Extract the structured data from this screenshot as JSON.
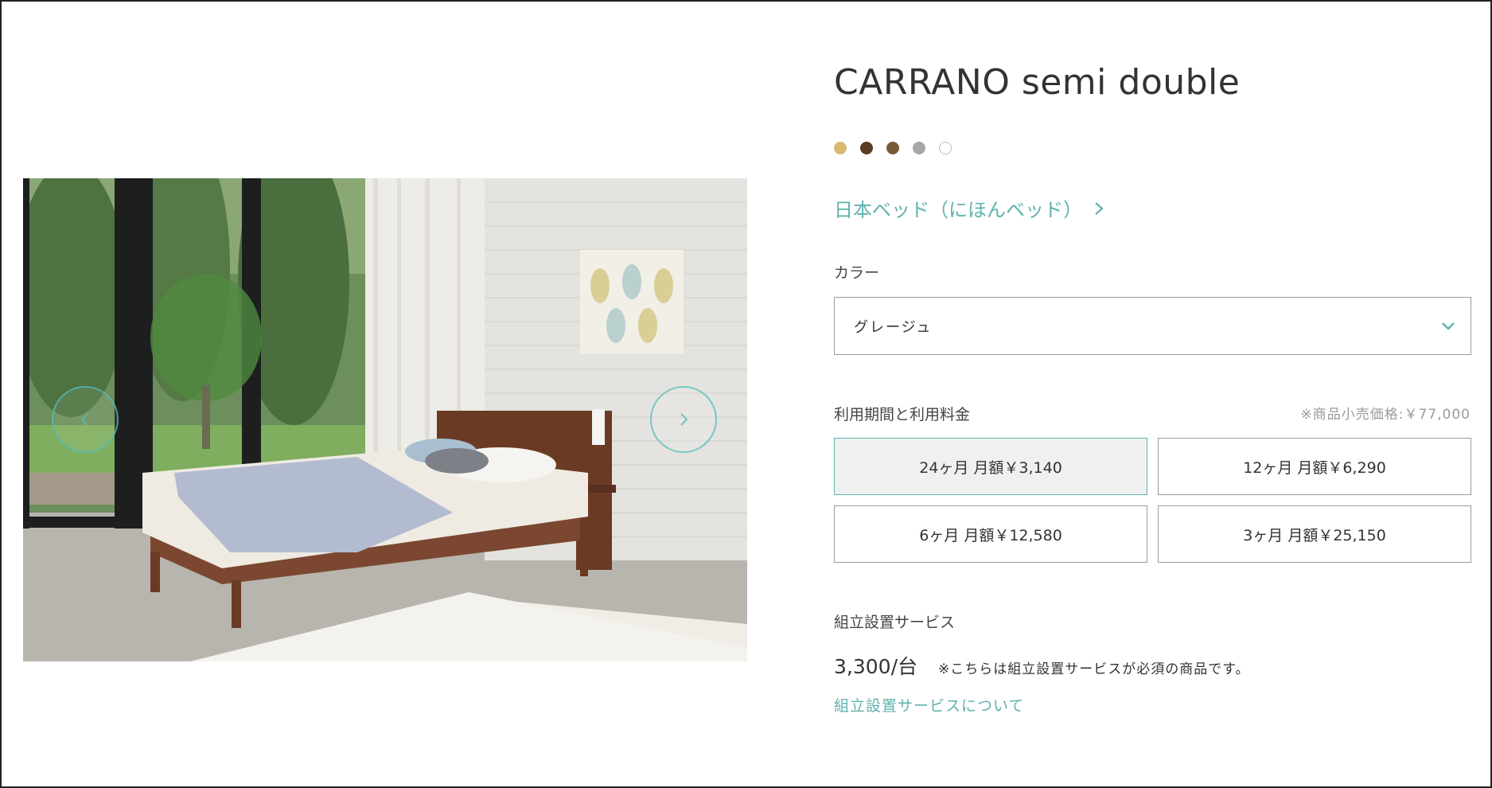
{
  "product": {
    "title": "CARRANO semi double",
    "brand_link": "日本ベッド（にほんベッド）",
    "swatches": [
      {
        "name": "beige",
        "color": "#d9b870"
      },
      {
        "name": "dark-brown",
        "color": "#5a3d22"
      },
      {
        "name": "brown",
        "color": "#7a5a35"
      },
      {
        "name": "gray",
        "color": "#a6a6a6"
      },
      {
        "name": "white",
        "color": "#ffffff"
      }
    ]
  },
  "color_section": {
    "label": "カラー",
    "selected_value": "グレージュ"
  },
  "plan_section": {
    "label": "利用期間と利用料金",
    "retail_note": "※商品小売価格:￥77,000",
    "plans": [
      {
        "label": "24ヶ月 月額￥3,140",
        "selected": true
      },
      {
        "label": "12ヶ月 月額￥6,290",
        "selected": false
      },
      {
        "label": "6ヶ月 月額￥12,580",
        "selected": false
      },
      {
        "label": "3ヶ月 月額￥25,150",
        "selected": false
      }
    ]
  },
  "service_section": {
    "label": "組立設置サービス",
    "price": "3,300/台",
    "required_note": "※こちらは組立設置サービスが必須の商品です。",
    "link": "組立設置サービスについて"
  },
  "colors": {
    "accent": "#5fb2ad",
    "border": "#9a9a9a",
    "text": "#333333"
  }
}
